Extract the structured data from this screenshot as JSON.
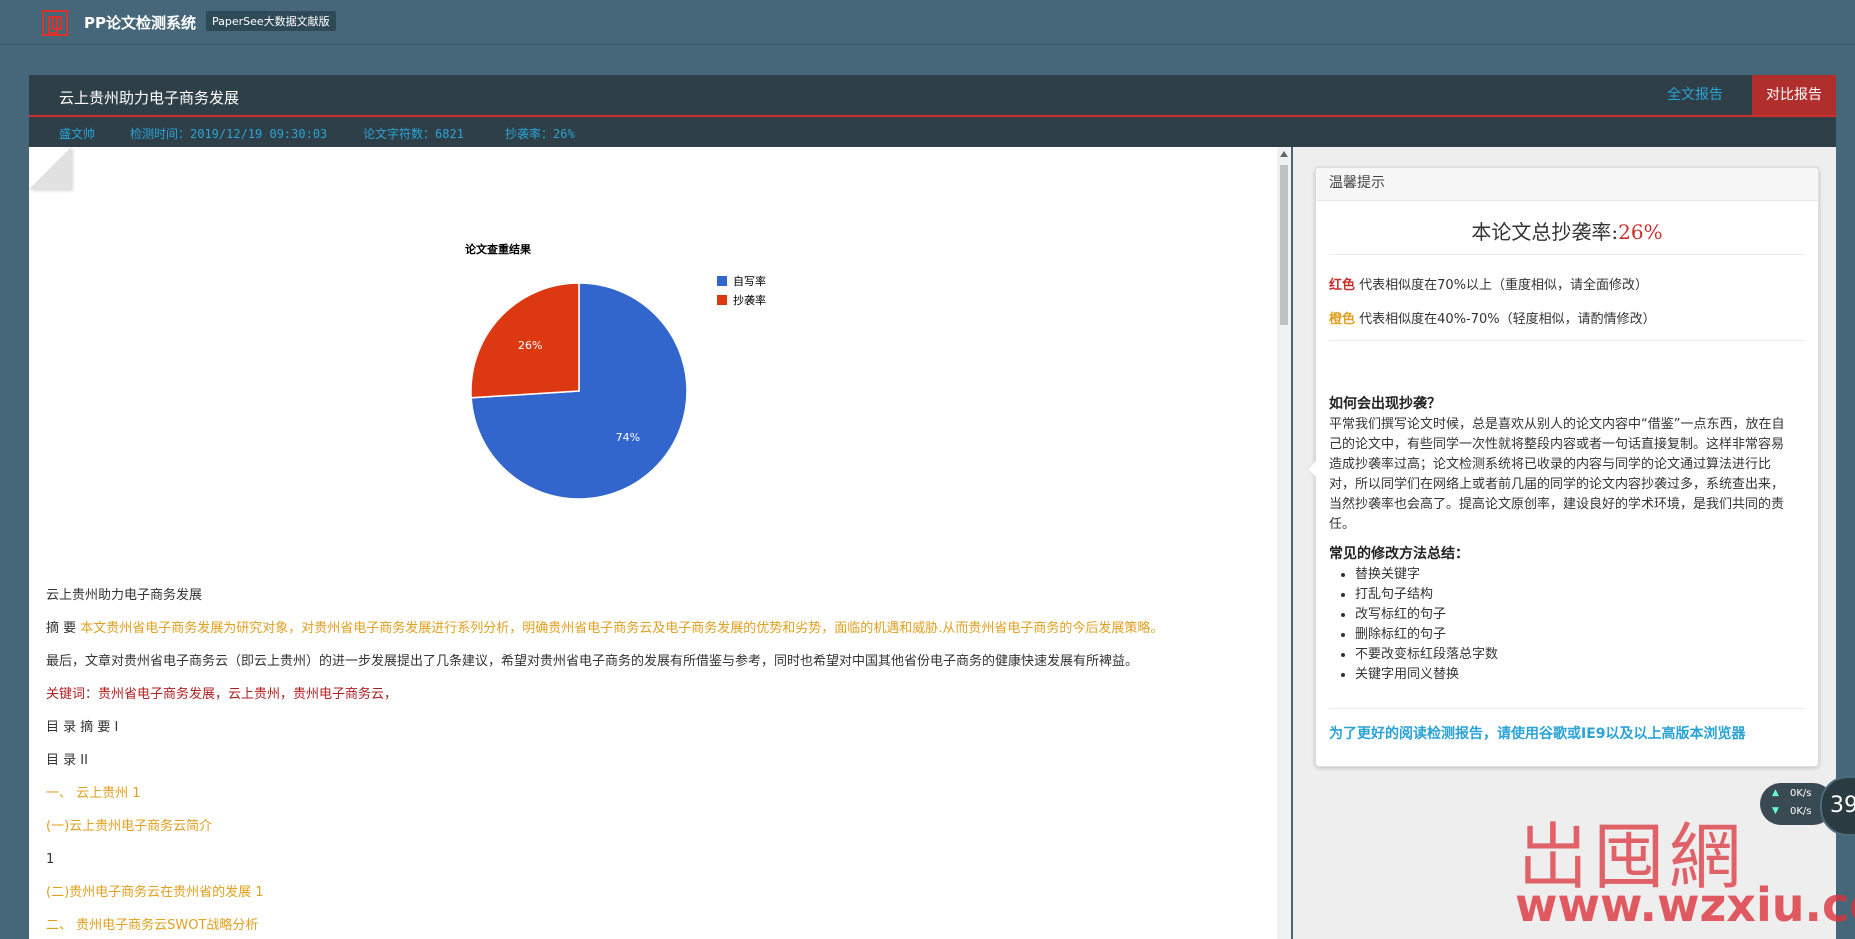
{
  "app": {
    "title": "PP论文检测系统",
    "badge": "PaperSee大数据文献版"
  },
  "report": {
    "title": "云上贵州助力电子商务发展",
    "tabs": {
      "full": "全文报告",
      "compare": "对比报告"
    },
    "meta": {
      "author": "盛文帅",
      "time": "检测时间：2019/12/19 09:30:03",
      "chars": "论文字符数：6821",
      "rate": "抄袭率：26%"
    }
  },
  "chart_data": {
    "type": "pie",
    "title": "论文查重结果",
    "slices": [
      {
        "name": "自写率",
        "value": 74,
        "label": "74%",
        "color": "#3366cc"
      },
      {
        "name": "抄袭率",
        "value": 26,
        "label": "26%",
        "color": "#dc3912"
      }
    ],
    "legend_position": "right"
  },
  "doc": {
    "lines": [
      {
        "text": "云上贵州助力电子商务发展",
        "color": "dark"
      },
      {
        "prefix": "摘  要 ",
        "text": "本文贵州省电子商务发展为研究对象，对贵州省电子商务发展进行系列分析，明确贵州省电子商务云及电子商务发展的优势和劣势，面临的机遇和威胁.从而贵州省电子商务的今后发展策略。",
        "color": "orange"
      },
      {
        "text": "最后，文章对贵州省电子商务云（即云上贵州）的进一步发展提出了几条建议，希望对贵州省电子商务的发展有所借鉴与参考，同时也希望对中国其他省份电子商务的健康快速发展有所裨益。",
        "color": "dark"
      },
      {
        "text": "关键词：贵州省电子商务发展，云上贵州，贵州电子商务云，",
        "color": "red"
      },
      {
        "text": "目 录 摘 要 I",
        "color": "dark"
      },
      {
        "text": "目 录 II",
        "color": "dark"
      },
      {
        "text": "一、 云上贵州 1",
        "color": "orange"
      },
      {
        "text": "(一)云上贵州电子商务云简介",
        "color": "orange"
      },
      {
        "text": "1",
        "color": "dark"
      },
      {
        "text": "(二)贵州电子商务云在贵州省的发展 1",
        "color": "orange"
      },
      {
        "text": "二、 贵州电子商务云SWOT战略分析",
        "color": "orange"
      }
    ]
  },
  "tip": {
    "header": "温馨提示",
    "total_label": "本论文总抄袭率:",
    "total_rate": "26%",
    "red_label": "红色",
    "red_desc": "代表相似度在70%以上（重度相似，请全面修改）",
    "orange_label": "橙色",
    "orange_desc": "代表相似度在40%-70%（轻度相似，请酌情修改）",
    "q_title": "如何会出现抄袭？",
    "q_body": "平常我们撰写论文时候，总是喜欢从别人的论文内容中“借鉴”一点东西，放在自己的论文中，有些同学一次性就将整段内容或者一句话直接复制。这样非常容易造成抄袭率过高；论文检测系统将已收录的内容与同学的论文通过算法进行比对，所以同学们在网络上或者前几届的同学的论文内容抄袭过多，系统查出来，当然抄袭率也会高了。提高论文原创率，建设良好的学术环境，是我们共同的责任。",
    "m_title": "常见的修改方法总结：",
    "methods": [
      "替换关键字",
      "打乱句子结构",
      "改写标红的句子",
      "删除标红的句子",
      "不要改变标红段落总字数",
      "关键字用同义替换"
    ],
    "browser_tip": "为了更好的阅读检测报告，请使用谷歌或IE9以及以上高版本浏览器"
  },
  "speed": {
    "up": "0K/s",
    "down": "0K/s",
    "badge": "39"
  },
  "watermark": {
    "cn": "岀囤網",
    "url": "www.wzxiu.com"
  }
}
